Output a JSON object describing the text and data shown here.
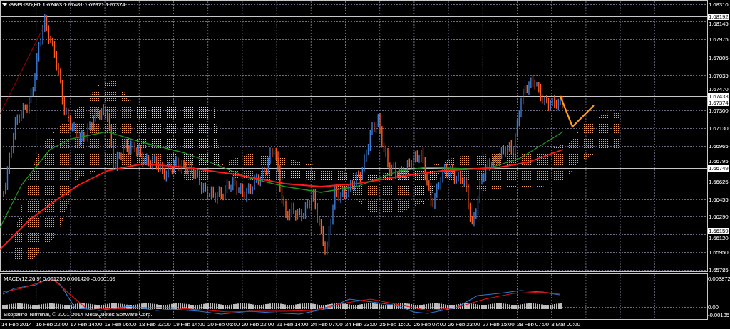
{
  "chart_header": {
    "text": "GBPUSD,H1 1.67463 1.67481 1.67371 1.67374"
  },
  "price_axis": {
    "labels": [
      {
        "text": "1.68310",
        "kind": "tick"
      },
      {
        "text": "1.68192",
        "kind": "level"
      },
      {
        "text": "1.68145",
        "kind": "tick"
      },
      {
        "text": "1.67975",
        "kind": "tick"
      },
      {
        "text": "1.67805",
        "kind": "tick"
      },
      {
        "text": "1.67635",
        "kind": "tick"
      },
      {
        "text": "1.67470",
        "kind": "tick"
      },
      {
        "text": "1.67433",
        "kind": "level"
      },
      {
        "text": "1.67374",
        "kind": "level"
      },
      {
        "text": "1.67300",
        "kind": "tick"
      },
      {
        "text": "1.67130",
        "kind": "tick"
      },
      {
        "text": "1.66965",
        "kind": "tick"
      },
      {
        "text": "1.66795",
        "kind": "tick"
      },
      {
        "text": "1.66749",
        "kind": "level"
      },
      {
        "text": "1.66625",
        "kind": "tick"
      },
      {
        "text": "1.66455",
        "kind": "tick"
      },
      {
        "text": "1.66290",
        "kind": "tick"
      },
      {
        "text": "1.66159",
        "kind": "level"
      },
      {
        "text": "1.66120",
        "kind": "tick"
      },
      {
        "text": "1.65950",
        "kind": "tick"
      },
      {
        "text": "1.65785",
        "kind": "tick"
      }
    ]
  },
  "macd_panel": {
    "legend": "MACD(12,26,9) 0.001250 0.001420 -0.000169",
    "copyright": "Skopalino Terminal, © 2001-2014 MetaQuotes Software Corp.",
    "axis_labels": [
      {
        "text": "0.003872",
        "kind": "top"
      },
      {
        "text": "0.00",
        "kind": "zero"
      },
      {
        "text": "-0.00135",
        "kind": "bottom"
      }
    ]
  },
  "time_axis": {
    "labels": [
      "14 Feb 2014",
      "16 Feb 22:00",
      "17 Feb 14:00",
      "18 Feb 06:00",
      "18 Feb 22:00",
      "19 Feb 14:00",
      "20 Feb 06:00",
      "20 Feb 22:00",
      "21 Feb 14:00",
      "24 Feb 07:00",
      "24 Feb 23:00",
      "25 Feb 15:00",
      "26 Feb 07:00",
      "26 Feb 23:00",
      "27 Feb 15:00",
      "28 Feb 07:00",
      "3 Mar 00:00"
    ]
  }
}
